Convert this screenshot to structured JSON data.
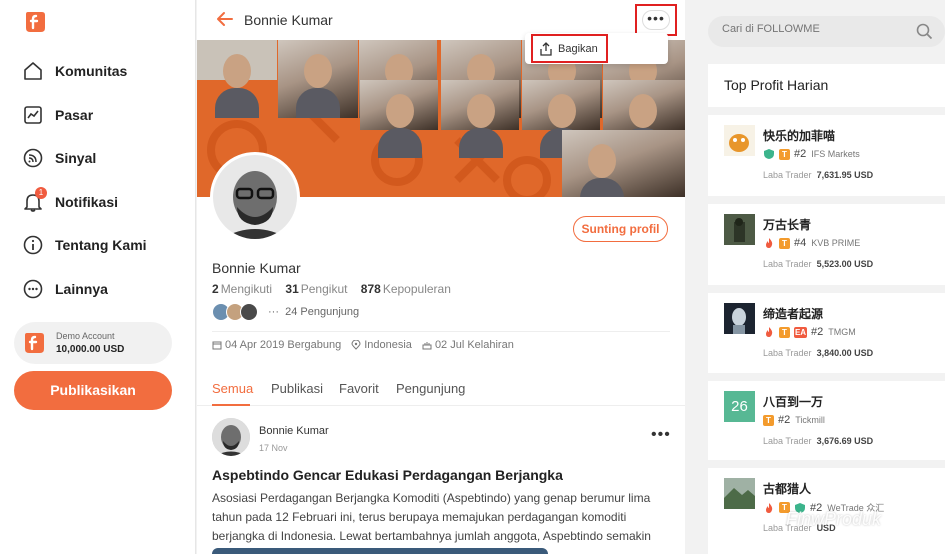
{
  "sidebar": {
    "items": [
      {
        "label": "Komunitas",
        "icon": "home-icon"
      },
      {
        "label": "Pasar",
        "icon": "chart-icon"
      },
      {
        "label": "Sinyal",
        "icon": "signal-icon"
      },
      {
        "label": "Notifikasi",
        "icon": "bell-icon",
        "badge": "1"
      },
      {
        "label": "Tentang Kami",
        "icon": "info-icon"
      },
      {
        "label": "Lainnya",
        "icon": "more-icon"
      }
    ],
    "account": {
      "name": "Demo Account",
      "balance": "10,000.00 USD"
    },
    "publish_label": "Publikasikan"
  },
  "header": {
    "title": "Bonnie Kumar",
    "menu_share": "Bagikan"
  },
  "profile": {
    "edit_label": "Sunting profil",
    "name": "Bonnie Kumar",
    "following_count": "2",
    "following_label": "Mengikuti",
    "followers_count": "31",
    "followers_label": "Pengikut",
    "popularity_count": "878",
    "popularity_label": "Kepopuleran",
    "visitors_text": "24 Pengunjung",
    "joined": "04 Apr 2019 Bergabung",
    "location": "Indonesia",
    "birthday": "02 Jul Kelahiran"
  },
  "tabs": [
    "Semua",
    "Publikasi",
    "Favorit",
    "Pengunjung"
  ],
  "post": {
    "author": "Bonnie Kumar",
    "date": "17 Nov",
    "title": "Aspebtindo Gencar Edukasi Perdagangan Berjangka",
    "body": "Asosiasi Perdagangan Berjangka Komoditi (Aspebtindo) yang genap berumur lima tahun pada 12 Februari ini, terus berupaya memajukan perdagangan komoditi berjangka di Indonesia. Lewat bertambahnya jumlah anggota, Aspebtindo semakin ..."
  },
  "search": {
    "placeholder": "Cari di FOLLOWME"
  },
  "ranking": {
    "title": "Top Profit Harian",
    "items": [
      {
        "name": "快乐的加菲喵",
        "rank": "#2",
        "broker": "IFS Markets",
        "profit_label": "Laba Trader",
        "profit": "7,631.95 USD"
      },
      {
        "name": "万古长青",
        "rank": "#4",
        "broker": "KVB PRIME",
        "profit_label": "Laba Trader",
        "profit": "5,523.00 USD"
      },
      {
        "name": "缔造者起源",
        "rank": "#2",
        "broker": "TMGM",
        "profit_label": "Laba Trader",
        "profit": "3,840.00 USD"
      },
      {
        "name": "八百到一万",
        "rank": "#2",
        "broker": "Tickmill",
        "profit_label": "Laba Trader",
        "profit": "3,676.69 USD",
        "avatar_text": "26"
      },
      {
        "name": "古都猎人",
        "rank": "#2",
        "broker": "WeTrade 众汇",
        "profit_label": "Laba Trader",
        "profit": "USD"
      }
    ]
  },
  "watermark": "FinwProduk",
  "colors": {
    "accent": "#f26d3f",
    "highlight_box": "#e02020",
    "shield": "#3cb48c",
    "flame": "#f05b3f"
  }
}
